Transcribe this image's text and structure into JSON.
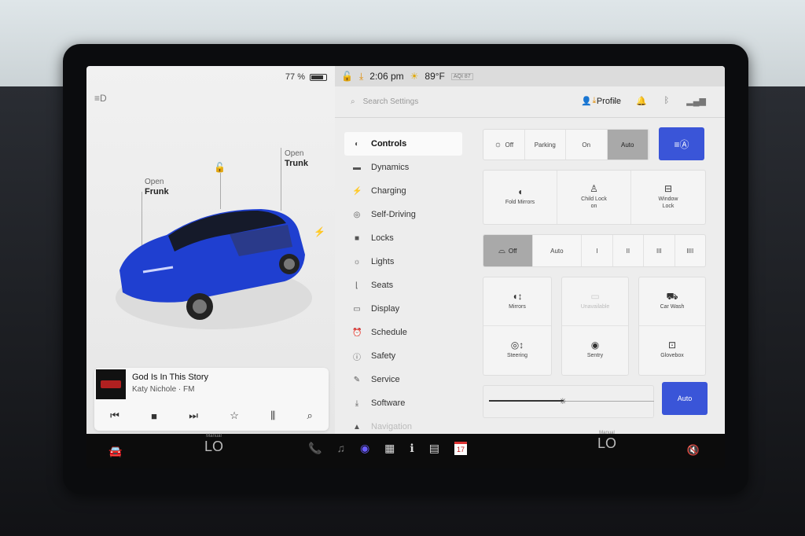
{
  "status": {
    "battery": "77 %",
    "time": "2:06 pm",
    "temp": "89°F",
    "aqi": "AQI 87"
  },
  "left": {
    "frunk_open": "Open",
    "frunk": "Frunk",
    "trunk_open": "Open",
    "trunk": "Trunk"
  },
  "music": {
    "title": "God Is In This Story",
    "artist": "Katy Nichole · FM"
  },
  "search": {
    "placeholder": "Search Settings"
  },
  "profile": "Profile",
  "menu": [
    {
      "label": "Controls"
    },
    {
      "label": "Dynamics"
    },
    {
      "label": "Charging"
    },
    {
      "label": "Self-Driving"
    },
    {
      "label": "Locks"
    },
    {
      "label": "Lights"
    },
    {
      "label": "Seats"
    },
    {
      "label": "Display"
    },
    {
      "label": "Schedule"
    },
    {
      "label": "Safety"
    },
    {
      "label": "Service"
    },
    {
      "label": "Software"
    },
    {
      "label": "Navigation"
    }
  ],
  "lights": {
    "off": "Off",
    "parking": "Parking",
    "on": "On",
    "auto": "Auto"
  },
  "tiles1": {
    "fold": "Fold Mirrors",
    "child": "Child Lock",
    "child_state": "on",
    "window": "Window",
    "window2": "Lock"
  },
  "wipers": {
    "off": "Off",
    "auto": "Auto",
    "s1": "I",
    "s2": "II",
    "s3": "III",
    "s4": "IIII"
  },
  "tiles2": {
    "mirrors": "Mirrors",
    "unavailable": "Unavailable",
    "carwash": "Car Wash",
    "steering": "Steering",
    "sentry": "Sentry",
    "glovebox": "Glovebox"
  },
  "brightness": {
    "auto": "Auto",
    "level": 0.45
  },
  "dock": {
    "left_label": "Manual",
    "left_temp": "LO",
    "right_label": "Manual",
    "right_temp": "LO",
    "calendar_day": "17"
  },
  "colors": {
    "accent": "#3a55d8",
    "car": "#1f3fd0"
  }
}
